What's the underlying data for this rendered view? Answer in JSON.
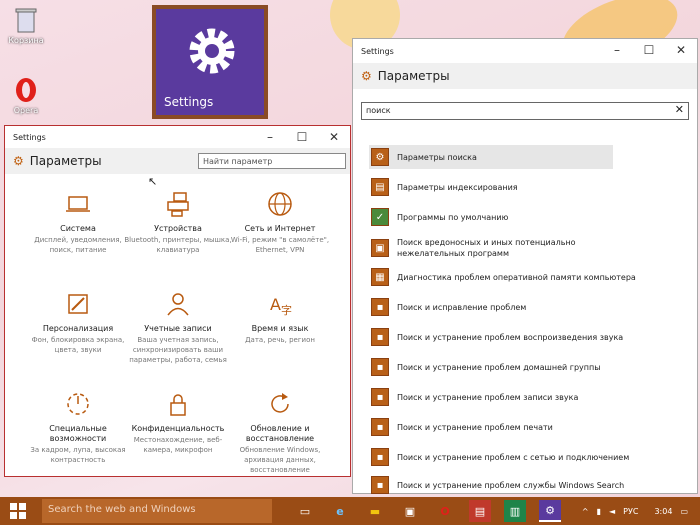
{
  "desktop": {
    "icons": [
      {
        "label": "Корзина",
        "icon": "recycle-bin-icon"
      },
      {
        "label": "Opera",
        "icon": "opera-icon"
      }
    ],
    "tile": {
      "label": "Settings",
      "icon": "gear-icon"
    }
  },
  "left_window": {
    "title": "Settings",
    "header": "Параметры",
    "search_placeholder": "Найти параметр",
    "categories": [
      {
        "title": "Система",
        "desc": "Дисплей, уведомления, поиск, питание",
        "icon": "laptop-icon"
      },
      {
        "title": "Устройства",
        "desc": "Bluetooth, принтеры, мышка, клавиатура",
        "icon": "devices-icon"
      },
      {
        "title": "Сеть и Интернет",
        "desc": "Wi-Fi, режим \"в самолёте\", Ethernet, VPN",
        "icon": "globe-icon"
      },
      {
        "title": "Персонализация",
        "desc": "Фон, блокировка экрана, цвета, звуки",
        "icon": "personalization-icon"
      },
      {
        "title": "Учетные записи",
        "desc": "Ваша учетная запись, синхронизировать ваши параметры, работа, семья",
        "icon": "person-icon"
      },
      {
        "title": "Время и язык",
        "desc": "Дата, речь, регион",
        "icon": "time-language-icon"
      },
      {
        "title": "Специальные возможности",
        "desc": "За кадром, лупа, высокая контрастность",
        "icon": "accessibility-icon"
      },
      {
        "title": "Конфиденциальность",
        "desc": "Местонахождение, веб-камера, микрофон",
        "icon": "lock-icon"
      },
      {
        "title": "Обновление и восстановление",
        "desc": "Обновление Windows, архивация данных, восстановление",
        "icon": "refresh-icon"
      }
    ]
  },
  "right_window": {
    "title": "Settings",
    "header": "Параметры",
    "search_value": "поиск",
    "results": [
      "Параметры поиска",
      "Параметры индексирования",
      "Программы по умолчанию",
      "Поиск вредоносных и иных потенциально нежелательных программ",
      "Диагностика проблем оперативной памяти компьютера",
      "Поиск и исправление проблем",
      "Поиск и устранение проблем воспроизведения звука",
      "Поиск и устранение проблем домашней группы",
      "Поиск и устранение проблем записи звука",
      "Поиск и устранение проблем печати",
      "Поиск и устранение проблем с сетью и подключением",
      "Поиск и устранение проблем службы Windows Search"
    ]
  },
  "taskbar": {
    "search_placeholder": "Search the web and Windows",
    "language": "РУС",
    "time": "3:04"
  },
  "colors": {
    "accent": "#b85a10",
    "taskbar": "#9a4c15",
    "tile": "#5a3a9e"
  }
}
